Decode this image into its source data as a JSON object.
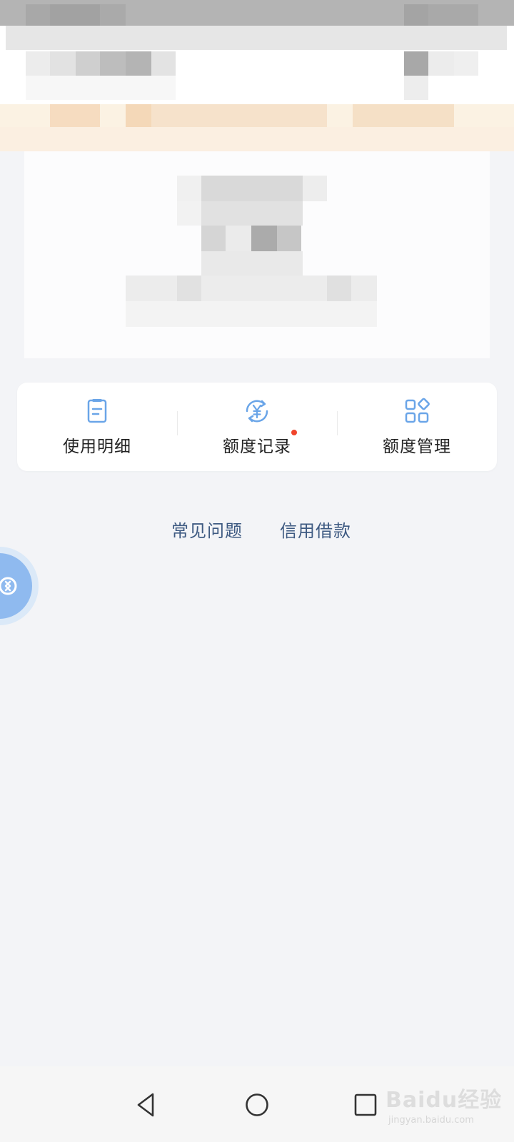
{
  "shortcuts": [
    {
      "label": "使用明细",
      "icon": "document-list-icon"
    },
    {
      "label": "额度记录",
      "icon": "yen-refresh-icon",
      "badge": "red-dot"
    },
    {
      "label": "额度管理",
      "icon": "apps-grid-icon"
    }
  ],
  "links": {
    "faq": "常见问题",
    "credit_loan": "信用借款"
  },
  "floating_button": {
    "icon": "collapse-arrow-icon"
  },
  "nav_bar": {
    "back_icon": "triangle-back-icon",
    "home_icon": "circle-home-icon",
    "recent_icon": "square-recents-icon"
  },
  "watermark": {
    "brand": "Baidu经验",
    "url": "jingyan.baidu.com"
  },
  "colors": {
    "accent_blue": "#6aa5e8",
    "link_blue": "#3e5a82",
    "badge_red": "#f0452c",
    "background": "#f3f4f7"
  }
}
